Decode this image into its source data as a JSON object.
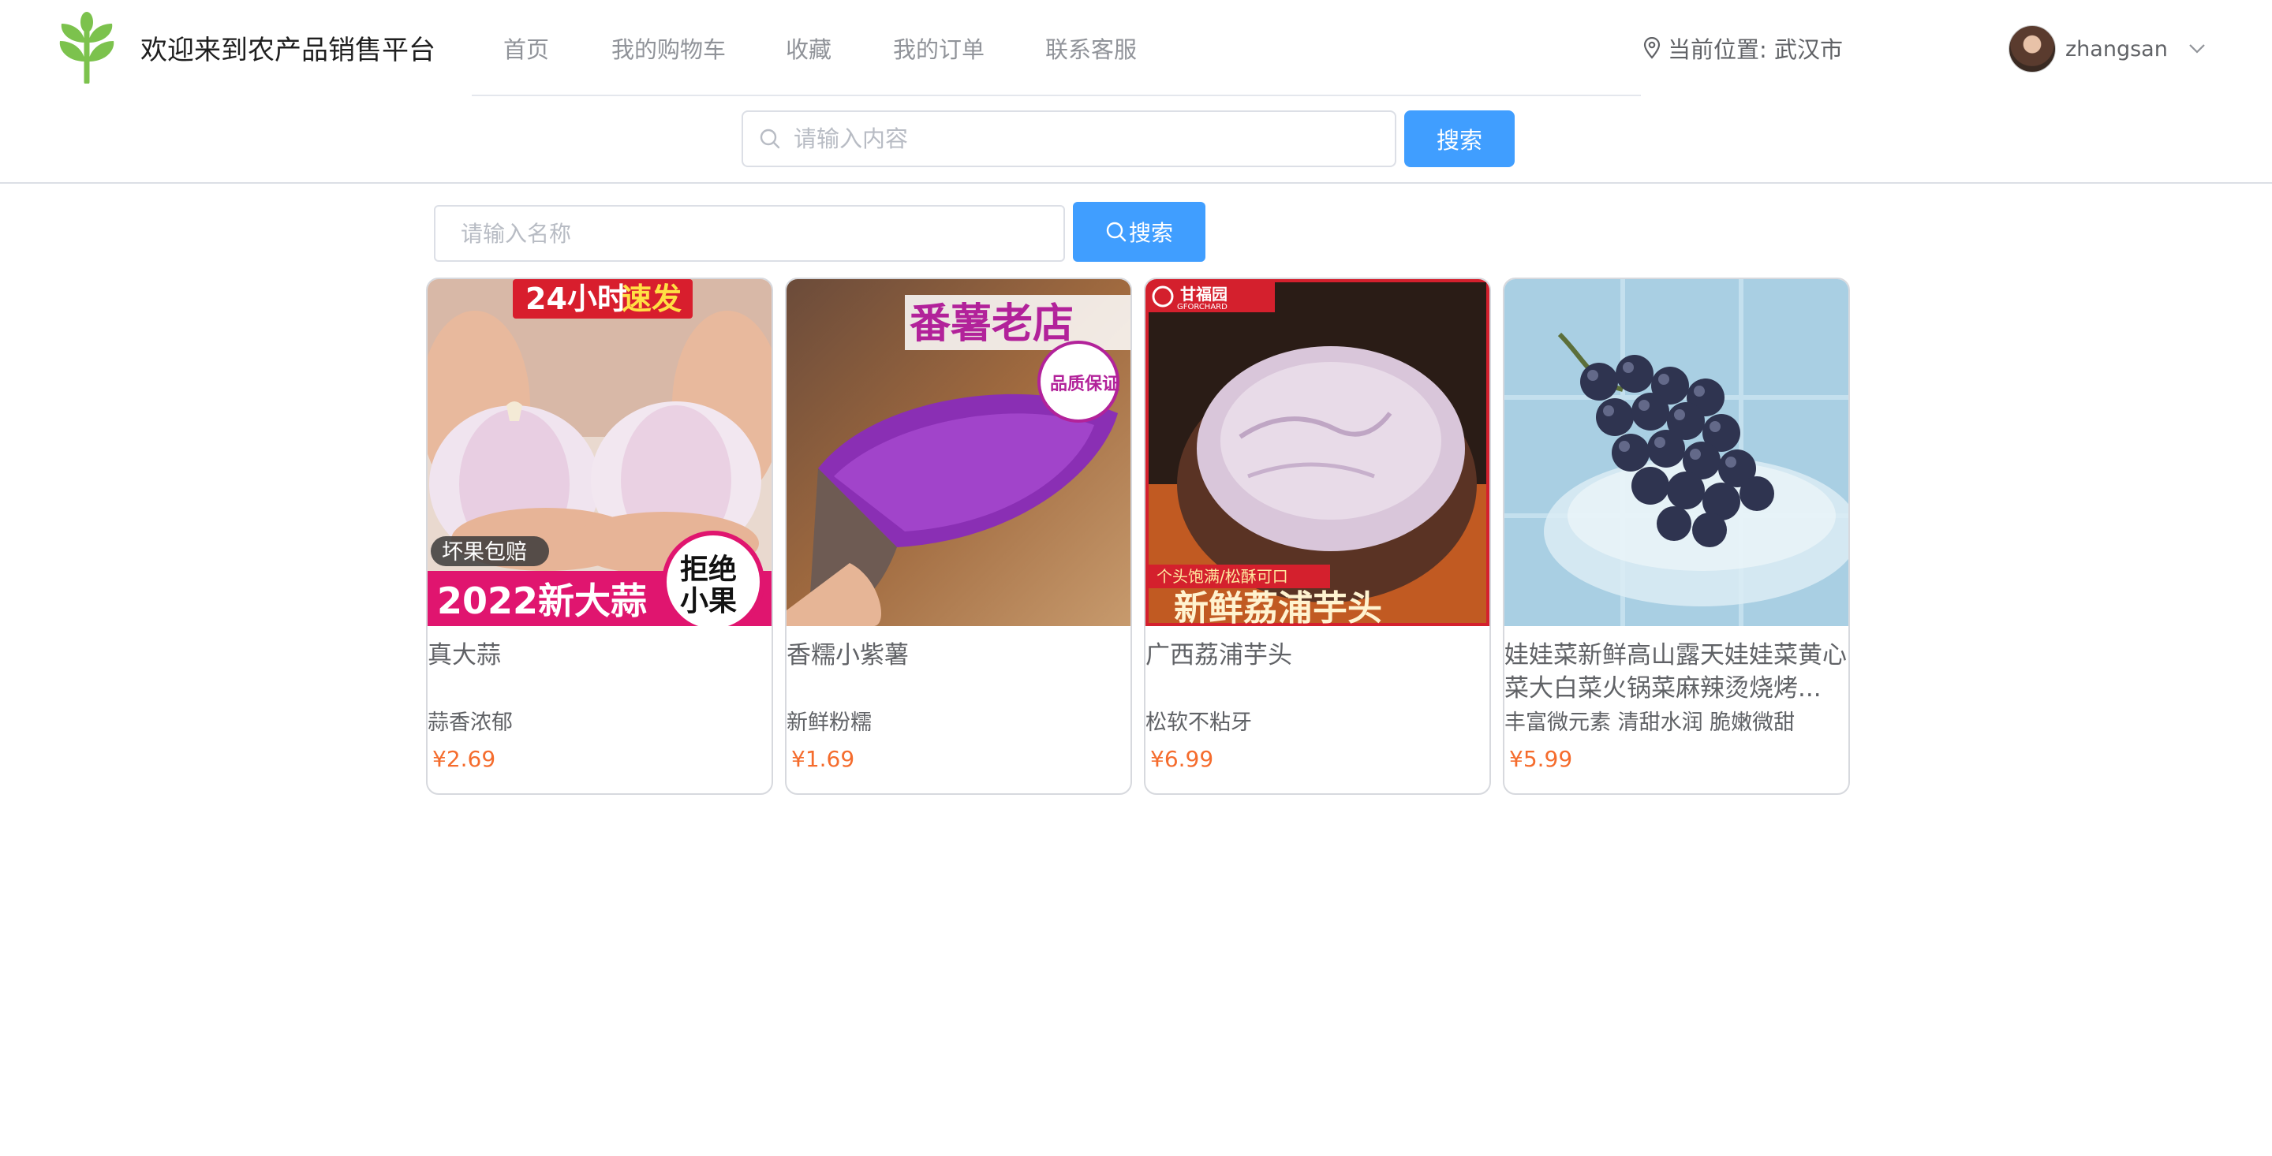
{
  "header": {
    "site_title": "欢迎来到农产品销售平台",
    "logo_icon": "leaf-sprout-icon",
    "nav": [
      {
        "label": "首页"
      },
      {
        "label": "我的购物车"
      },
      {
        "label": "收藏"
      },
      {
        "label": "我的订单"
      },
      {
        "label": "联系客服"
      }
    ],
    "location_label": "当前位置: 武汉市",
    "location_icon": "map-pin-icon",
    "username": "zhangsan",
    "search": {
      "placeholder": "请输入内容",
      "value": "",
      "button_label": "搜索"
    }
  },
  "filter": {
    "placeholder": "请输入名称",
    "value": "",
    "button_label": "搜索"
  },
  "colors": {
    "primary": "#409eff",
    "price": "#f56c2d",
    "logo_green": "#7cc24d"
  },
  "products": [
    {
      "name": "真大蒜",
      "desc": "蒜香浓郁",
      "price": "¥2.69",
      "image": {
        "subject": "garlic",
        "banner_text_a": "24小时",
        "banner_text_b": "速发",
        "badge_text": "坏果包赔",
        "bottom_text": "2022新大蒜",
        "circle_line1": "拒绝",
        "circle_line2": "小果"
      }
    },
    {
      "name": "香糯小紫薯",
      "desc": "新鲜粉糯",
      "price": "¥1.69",
      "image": {
        "subject": "purple-sweet-potato",
        "title_text": "番薯老店",
        "seal_text": "品质保证"
      }
    },
    {
      "name": "广西荔浦芋头",
      "desc": "松软不粘牙",
      "price": "¥6.99",
      "image": {
        "subject": "taro",
        "brand_text": "甘福园",
        "brand_sub": "GFORCHARD",
        "tag_text": "个头饱满/松酥可口",
        "bottom_text": "新鲜荔浦芋头"
      }
    },
    {
      "name": "娃娃菜新鲜高山露天娃娃菜黄心菜大白菜火锅菜麻辣烫烧烤...",
      "desc": "丰富微元素 清甜水润 脆嫩微甜",
      "price": "¥5.99",
      "image": {
        "subject": "grapes"
      }
    }
  ]
}
